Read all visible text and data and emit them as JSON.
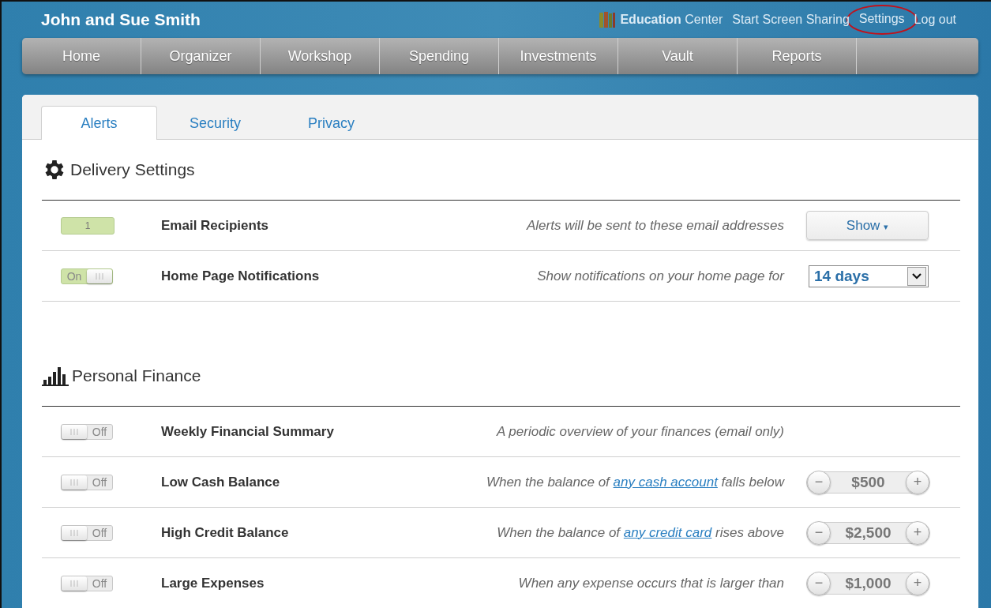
{
  "header": {
    "user_name": "John and Sue Smith",
    "links": [
      {
        "kind": "education",
        "label_bold": "Education",
        "label": "Center",
        "highlighted": false
      },
      {
        "kind": "plain",
        "label": "Start Screen Sharing",
        "highlighted": false
      },
      {
        "kind": "plain",
        "label": "Settings",
        "highlighted": true
      },
      {
        "kind": "plain",
        "label": "Log out",
        "highlighted": false
      }
    ]
  },
  "nav": [
    "Home",
    "Organizer",
    "Workshop",
    "Spending",
    "Investments",
    "Vault",
    "Reports"
  ],
  "tabs": [
    {
      "label": "Alerts",
      "selected": true
    },
    {
      "label": "Security",
      "selected": false
    },
    {
      "label": "Privacy",
      "selected": false
    }
  ],
  "sections": [
    {
      "kind": "gear",
      "title": "Delivery Settings",
      "rows": [
        {
          "switch": {
            "kind": "count",
            "text": "1"
          },
          "label": "Email Recipients",
          "description": [
            {
              "kind": "text",
              "text": "Alerts will be sent to these email addresses"
            }
          ],
          "control": {
            "kind": "button",
            "label": "Show",
            "caret": "▾"
          }
        },
        {
          "switch": {
            "kind": "toggle",
            "on": true,
            "text": "On"
          },
          "label": "Home Page Notifications",
          "description": [
            {
              "kind": "text",
              "text": "Show notifications on your home page for"
            }
          ],
          "control": {
            "kind": "select",
            "value": "14 days"
          }
        }
      ]
    },
    {
      "kind": "chart",
      "title": "Personal Finance",
      "rows": [
        {
          "switch": {
            "kind": "toggle",
            "on": false,
            "text": "Off"
          },
          "label": "Weekly Financial Summary",
          "description": [
            {
              "kind": "text",
              "text": "A periodic overview of your finances (email only)"
            }
          ]
        },
        {
          "switch": {
            "kind": "toggle",
            "on": false,
            "text": "Off"
          },
          "label": "Low Cash Balance",
          "description": [
            {
              "kind": "text",
              "text": "When the balance of "
            },
            {
              "kind": "link",
              "text": "any cash account"
            },
            {
              "kind": "text",
              "text": " falls below"
            }
          ],
          "control": {
            "kind": "stepper",
            "value": "$500",
            "minus": "−",
            "plus": "+"
          }
        },
        {
          "switch": {
            "kind": "toggle",
            "on": false,
            "text": "Off"
          },
          "label": "High Credit Balance",
          "description": [
            {
              "kind": "text",
              "text": "When the balance of "
            },
            {
              "kind": "link",
              "text": "any credit card"
            },
            {
              "kind": "text",
              "text": " rises above"
            }
          ],
          "control": {
            "kind": "stepper",
            "value": "$2,500",
            "minus": "−",
            "plus": "+"
          }
        },
        {
          "switch": {
            "kind": "toggle",
            "on": false,
            "text": "Off"
          },
          "label": "Large Expenses",
          "description": [
            {
              "kind": "text",
              "text": "When any expense occurs that is larger than"
            }
          ],
          "control": {
            "kind": "stepper",
            "value": "$1,000",
            "minus": "−",
            "plus": "+"
          }
        }
      ]
    }
  ]
}
